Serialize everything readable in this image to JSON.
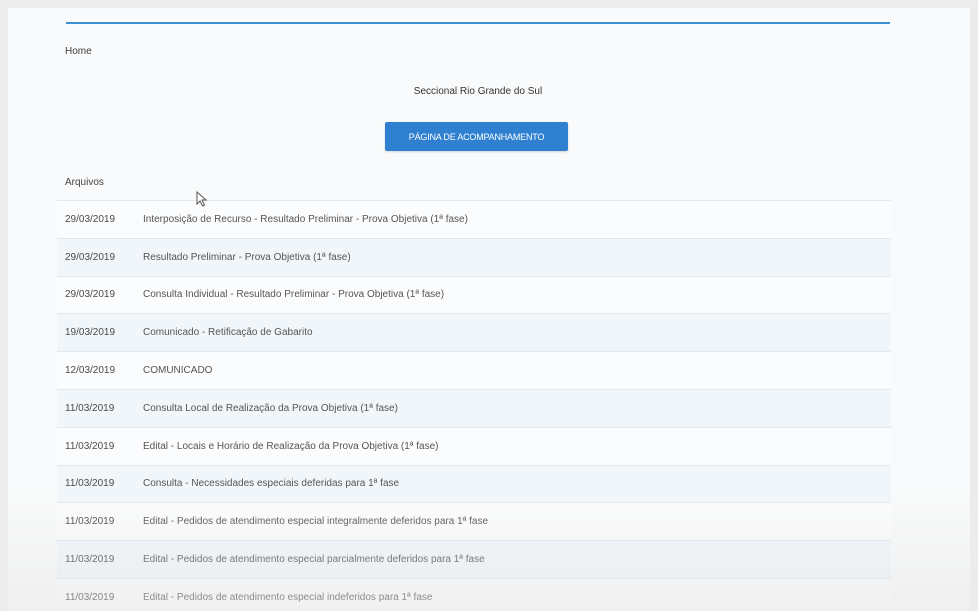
{
  "breadcrumb": {
    "home": "Home"
  },
  "header": {
    "section_title": "Seccional Rio Grande do Sul"
  },
  "main": {
    "button_label": "PÁGINA DE ACOMPANHAMENTO",
    "files_label": "Arquivos",
    "files": [
      {
        "date": "29/03/2019",
        "title": "Interposição de Recurso - Resultado Preliminar - Prova Objetiva (1ª fase)"
      },
      {
        "date": "29/03/2019",
        "title": "Resultado Preliminar - Prova Objetiva (1ª fase)"
      },
      {
        "date": "29/03/2019",
        "title": "Consulta Individual - Resultado Preliminar - Prova Objetiva (1ª fase)"
      },
      {
        "date": "19/03/2019",
        "title": "Comunicado - Retificação de Gabarito"
      },
      {
        "date": "12/03/2019",
        "title": "COMUNICADO"
      },
      {
        "date": "11/03/2019",
        "title": "Consulta Local de Realização da Prova Objetiva (1ª fase)"
      },
      {
        "date": "11/03/2019",
        "title": "Edital - Locais e Horário de Realização da Prova Objetiva (1ª fase)"
      },
      {
        "date": "11/03/2019",
        "title": "Consulta - Necessidades especiais deferidas para 1ª fase"
      },
      {
        "date": "11/03/2019",
        "title": "Edital - Pedidos de atendimento especial integralmente deferidos para 1ª fase"
      },
      {
        "date": "11/03/2019",
        "title": "Edital - Pedidos de atendimento especial parcialmente deferidos para 1ª fase"
      },
      {
        "date": "11/03/2019",
        "title": "Edital - Pedidos de atendimento especial indeferidos para 1ª fase"
      }
    ]
  },
  "colors": {
    "accent": "#2f80d1",
    "top_rule": "#3d8fd0",
    "row_alt": "#f1f6fb"
  },
  "icons": {
    "pointer": "mouse-cursor-icon"
  }
}
